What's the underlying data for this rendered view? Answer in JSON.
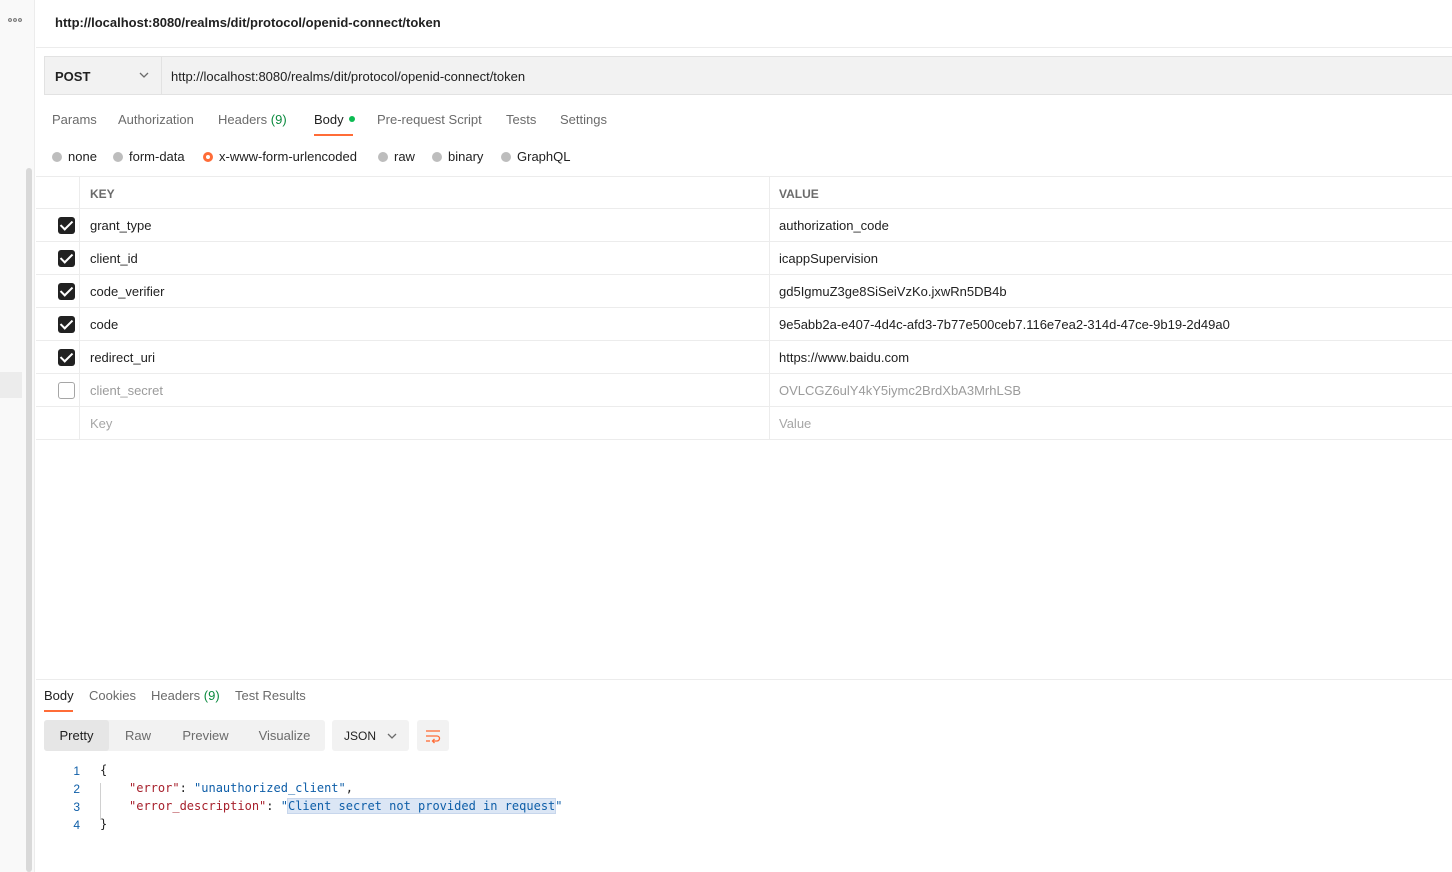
{
  "request": {
    "title": "http://localhost:8080/realms/dit/protocol/openid-connect/token",
    "method": "POST",
    "url": "http://localhost:8080/realms/dit/protocol/openid-connect/token"
  },
  "request_tabs": [
    {
      "label": "Params"
    },
    {
      "label": "Authorization"
    },
    {
      "label": "Headers",
      "count": "(9)"
    },
    {
      "label": "Body",
      "active": true
    },
    {
      "label": "Pre-request Script"
    },
    {
      "label": "Tests"
    },
    {
      "label": "Settings"
    }
  ],
  "body_modes": [
    {
      "label": "none"
    },
    {
      "label": "form-data"
    },
    {
      "label": "x-www-form-urlencoded",
      "selected": true
    },
    {
      "label": "raw"
    },
    {
      "label": "binary"
    },
    {
      "label": "GraphQL"
    }
  ],
  "kv_table": {
    "headers": {
      "key": "KEY",
      "value": "VALUE"
    },
    "rows": [
      {
        "key": "grant_type",
        "value": "authorization_code",
        "enabled": true
      },
      {
        "key": "client_id",
        "value": "icappSupervision",
        "enabled": true
      },
      {
        "key": "code_verifier",
        "value": "gd5IgmuZ3ge8SiSeiVzKo.jxwRn5DB4b",
        "enabled": true
      },
      {
        "key": "code",
        "value": "9e5abb2a-e407-4d4c-afd3-7b77e500ceb7.116e7ea2-314d-47ce-9b19-2d49a0",
        "enabled": true
      },
      {
        "key": "redirect_uri",
        "value": "https://www.baidu.com",
        "enabled": true
      },
      {
        "key": "client_secret",
        "value": "OVLCGZ6ulY4kY5iymc2BrdXbA3MrhLSB",
        "enabled": false
      }
    ],
    "placeholder": {
      "key": "Key",
      "value": "Value"
    }
  },
  "response": {
    "tabs": [
      {
        "label": "Body",
        "active": true
      },
      {
        "label": "Cookies"
      },
      {
        "label": "Headers",
        "count": "(9)"
      },
      {
        "label": "Test Results"
      }
    ],
    "view_modes": [
      "Pretty",
      "Raw",
      "Preview",
      "Visualize"
    ],
    "active_view": "Pretty",
    "format": "JSON",
    "code_lines": [
      {
        "num": "1",
        "open": "{"
      },
      {
        "num": "2",
        "key": "\"error\"",
        "sep": ": ",
        "value": "\"unauthorized_client\"",
        "tail": ","
      },
      {
        "num": "3",
        "key": "\"error_description\"",
        "sep": ": ",
        "value_q1": "\"",
        "value_hl": "Client secret not provided in request",
        "value_q2": "\""
      },
      {
        "num": "4",
        "close": "}"
      }
    ]
  },
  "colors": {
    "accent": "#ff6c37",
    "success": "#0cbb52"
  }
}
